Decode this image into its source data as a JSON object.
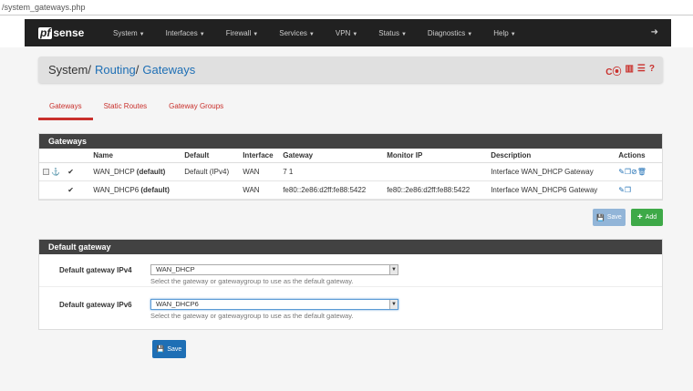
{
  "url": "/system_gateways.php",
  "brand": {
    "pf": "pf",
    "sense": "sense"
  },
  "nav": [
    {
      "label": "System"
    },
    {
      "label": "Interfaces"
    },
    {
      "label": "Firewall"
    },
    {
      "label": "Services"
    },
    {
      "label": "VPN"
    },
    {
      "label": "Status"
    },
    {
      "label": "Diagnostics"
    },
    {
      "label": "Help"
    }
  ],
  "breadcrumb": {
    "system": "System",
    "sep": "/",
    "routing": "Routing",
    "gateways": "Gateways"
  },
  "tabs": [
    {
      "label": "Gateways",
      "active": true
    },
    {
      "label": "Static Routes",
      "active": false
    },
    {
      "label": "Gateway Groups",
      "active": false
    }
  ],
  "gateways_panel": {
    "title": "Gateways",
    "columns": [
      "Name",
      "Default",
      "Interface",
      "Gateway",
      "Monitor IP",
      "Description",
      "Actions"
    ],
    "rows": [
      {
        "name": "WAN_DHCP",
        "name_suffix": "(default)",
        "default": "Default (IPv4)",
        "interface": "WAN",
        "gateway": "7        1",
        "monitor_ip": "",
        "description": "Interface WAN_DHCP Gateway"
      },
      {
        "name": "WAN_DHCP6",
        "name_suffix": "(default)",
        "default": "",
        "interface": "WAN",
        "gateway": "fe80::2e86:d2ff:fe88:5422",
        "monitor_ip": "fe80::2e86:d2ff:fe88:5422",
        "description": "Interface WAN_DHCP6 Gateway"
      }
    ]
  },
  "buttons": {
    "save_small": "Save",
    "add": "Add",
    "save_main": "Save"
  },
  "default_gateway_panel": {
    "title": "Default gateway",
    "ipv4": {
      "label": "Default gateway IPv4",
      "value": "WAN_DHCP",
      "help": "Select the gateway or gatewaygroup to use as the default gateway."
    },
    "ipv6": {
      "label": "Default gateway IPv6",
      "value": "WAN_DHCP6",
      "help": "Select the gateway or gatewaygroup to use as the default gateway."
    }
  },
  "colors": {
    "accent_red": "#c9302c",
    "link_blue": "#1e6fb5",
    "navbar": "#212121",
    "add_green": "#3ea948"
  }
}
